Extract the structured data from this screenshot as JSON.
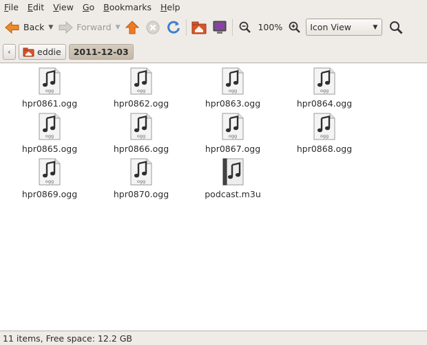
{
  "menubar": {
    "items": [
      {
        "label": "File",
        "underline": "F",
        "rest": "ile"
      },
      {
        "label": "Edit",
        "underline": "E",
        "rest": "dit"
      },
      {
        "label": "View",
        "underline": "V",
        "rest": "iew"
      },
      {
        "label": "Go",
        "underline": "G",
        "rest": "o"
      },
      {
        "label": "Bookmarks",
        "underline": "B",
        "rest": "ookmarks"
      },
      {
        "label": "Help",
        "underline": "H",
        "rest": "elp"
      }
    ]
  },
  "toolbar": {
    "back_label": "Back",
    "forward_label": "Forward",
    "zoom_level": "100%",
    "view_mode": "Icon View",
    "icons": [
      "back-arrow-icon",
      "forward-arrow-icon",
      "home-icon",
      "stop-icon",
      "reload-icon",
      "home-folder-icon",
      "computer-icon",
      "zoom-out-icon",
      "zoom-in-icon",
      "search-icon"
    ]
  },
  "location": {
    "crumbs": [
      "eddie",
      "2011-12-03"
    ]
  },
  "files": [
    {
      "name": "hpr0861.ogg",
      "type": "ogg"
    },
    {
      "name": "hpr0862.ogg",
      "type": "ogg"
    },
    {
      "name": "hpr0863.ogg",
      "type": "ogg"
    },
    {
      "name": "hpr0864.ogg",
      "type": "ogg"
    },
    {
      "name": "hpr0865.ogg",
      "type": "ogg"
    },
    {
      "name": "hpr0866.ogg",
      "type": "ogg"
    },
    {
      "name": "hpr0867.ogg",
      "type": "ogg"
    },
    {
      "name": "hpr0868.ogg",
      "type": "ogg"
    },
    {
      "name": "hpr0869.ogg",
      "type": "ogg"
    },
    {
      "name": "hpr0870.ogg",
      "type": "ogg"
    },
    {
      "name": "podcast.m3u",
      "type": "m3u"
    }
  ],
  "file_icon_label": "ogg",
  "status": {
    "text": "11 items, Free space: 12.2 GB"
  },
  "colors": {
    "window_bg": "#efebe7",
    "content_bg": "#ffffff",
    "active_crumb": "#c9bfb0",
    "back_arrow": "#e07a1f",
    "home": "#e86a1c"
  }
}
